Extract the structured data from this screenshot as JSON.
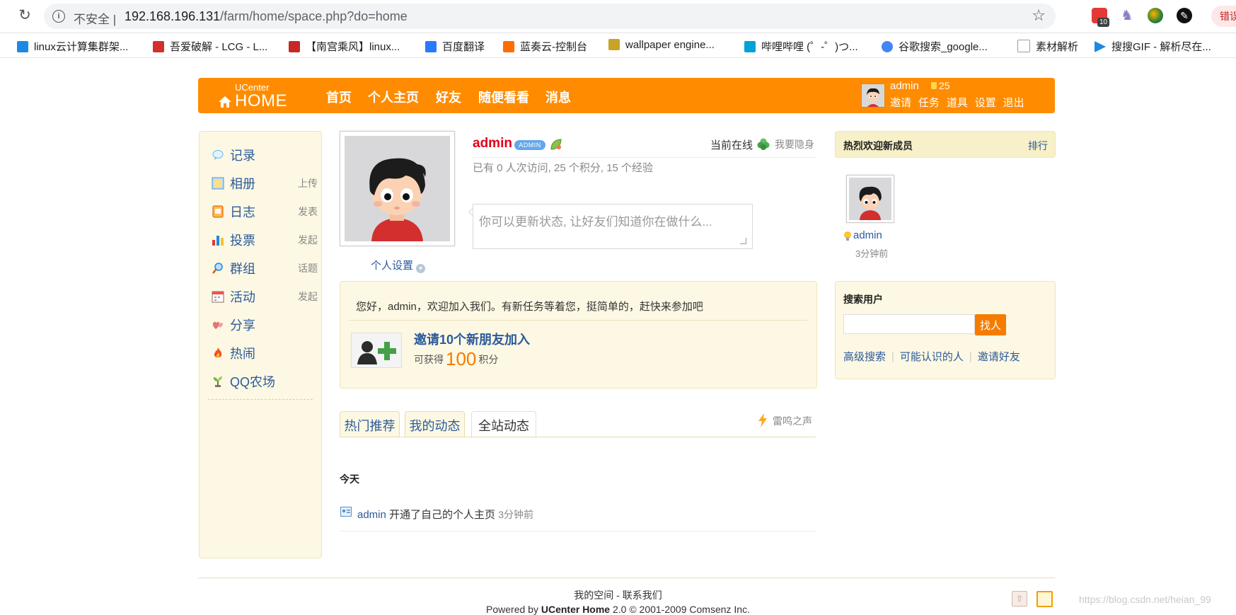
{
  "browser": {
    "security_label": "不安全",
    "url_host": "192.168.196.131",
    "url_path": "/farm/home/space.php?do=home",
    "ext_badge": "10",
    "profile_chip": "错误"
  },
  "bookmarks": [
    {
      "label": "linux云计算集群架...",
      "color": "#1e88e5"
    },
    {
      "label": "吾爱破解 - LCG - L...",
      "color": "#d32f2f"
    },
    {
      "label": "【南宫乘风】linux...",
      "color": "#c62828"
    },
    {
      "label": "百度翻译",
      "color": "#2979ff"
    },
    {
      "label": "蓝奏云-控制台",
      "color": "#ff6d00"
    },
    {
      "label": "wallpaper engine...",
      "color": "#c9a227"
    },
    {
      "label": "哔哩哔哩 (゜-゜)つ...",
      "color": "#00a1d6"
    },
    {
      "label": "谷歌搜索_google...",
      "color": "#4285f4"
    },
    {
      "label": "素材解析",
      "color": "#9e9e9e"
    },
    {
      "label": "搜搜GIF - 解析尽在...",
      "color": "#1e88e5"
    }
  ],
  "header": {
    "logo_small": "UCenter",
    "logo_big": "HOME",
    "nav": [
      "首页",
      "个人主页",
      "好友",
      "随便看看",
      "消息"
    ],
    "username": "admin",
    "credits": "25",
    "links": [
      "邀请",
      "任务",
      "道具",
      "设置",
      "退出"
    ]
  },
  "sidebar": {
    "items": [
      {
        "label": "记录",
        "action": ""
      },
      {
        "label": "相册",
        "action": "上传"
      },
      {
        "label": "日志",
        "action": "发表"
      },
      {
        "label": "投票",
        "action": "发起"
      },
      {
        "label": "群组",
        "action": "话题"
      },
      {
        "label": "活动",
        "action": "发起"
      },
      {
        "label": "分享",
        "action": ""
      },
      {
        "label": "热闹",
        "action": ""
      },
      {
        "label": "QQ农场",
        "action": ""
      }
    ]
  },
  "profile": {
    "name": "admin",
    "badge": "ADMIN",
    "online": "当前在线",
    "invisible": "我要隐身",
    "stats": "已有 0 人次访问, 25 个积分, 15 个经验",
    "settings": "个人设置",
    "status_placeholder": "你可以更新状态, 让好友们知道你在做什么..."
  },
  "task": {
    "welcome": "您好，admin，欢迎加入我们。有新任务等着您，挺简单的，赶快来参加吧",
    "title": "邀请10个新朋友加入",
    "reward_prefix": "可获得",
    "reward_value": "100",
    "reward_suffix": "积分"
  },
  "tabs": {
    "hot": "热门推荐",
    "mine": "我的动态",
    "all": "全站动态",
    "thunder": "雷鸣之声"
  },
  "feed": {
    "today": "今天",
    "user": "admin",
    "action": "开通了自己的个人主页",
    "time": "3分钟前"
  },
  "right": {
    "welcome_title": "热烈欢迎新成员",
    "rank": "排行",
    "member_name": "admin",
    "member_time": "3分钟前",
    "search_title": "搜索用户",
    "search_button": "找人",
    "search_links": [
      "高级搜索",
      "可能认识的人",
      "邀请好友"
    ]
  },
  "footer": {
    "links": "我的空间 - 联系我们",
    "power_prefix": "Powered by ",
    "power_brand": "UCenter Home",
    "power_suffix": " 2.0 © 2001-2009 Comsenz Inc.",
    "watermark": "https://blog.csdn.net/heian_99"
  }
}
